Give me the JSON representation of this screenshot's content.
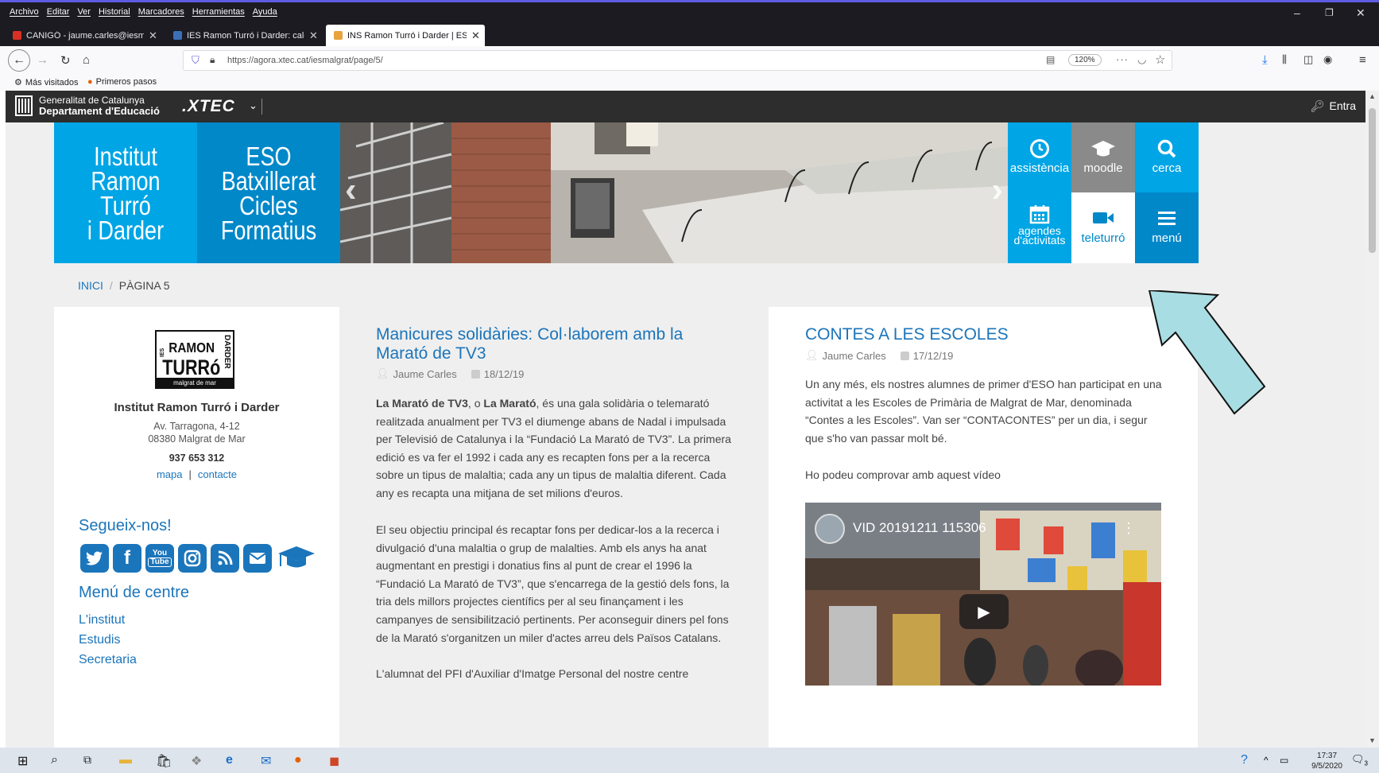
{
  "browser": {
    "menu": [
      "Archivo",
      "Editar",
      "Ver",
      "Historial",
      "Marcadores",
      "Herramientas",
      "Ayuda"
    ],
    "tabs": [
      {
        "label": "CANIGÓ - jaume.carles@iesma",
        "favicon_color": "#d93025"
      },
      {
        "label": "IES Ramon Turró i Darder: calen",
        "favicon_color": "#3b6fb6"
      },
      {
        "label": "INS Ramon Turró i Darder | ESO",
        "favicon_color": "#e8a33d"
      }
    ],
    "url": "https://agora.xtec.cat/iesmalgrat/page/5/",
    "zoom": "120%",
    "bookmarks": [
      "Más visitados",
      "Primeros pasos"
    ]
  },
  "xtec": {
    "gencat_line1": "Generalitat de Catalunya",
    "gencat_line2": "Departament d'Educació",
    "logo": ".XTEC",
    "login": "Entra"
  },
  "banner": {
    "title_lines": [
      "Institut",
      "Ramon Turró",
      "i Darder"
    ],
    "subtitle_lines": [
      "ESO Batxillerat",
      "Cicles",
      "Formatius"
    ],
    "tiles": [
      {
        "label": "assistència",
        "icon": "clock-icon",
        "bg": "#00a5e5"
      },
      {
        "label": "moodle",
        "icon": "mortarboard-icon",
        "bg": "#8a8a8a"
      },
      {
        "label": "cerca",
        "icon": "search-icon",
        "bg": "#00a5e5"
      },
      {
        "label": "agendes d'activitats",
        "icon": "calendar-icon",
        "bg": "#00a5e5"
      },
      {
        "label": "teleturró",
        "icon": "video-camera-icon",
        "bg": "#ffffff"
      },
      {
        "label": "menú",
        "icon": "hamburger-icon",
        "bg": "#0088c9"
      }
    ]
  },
  "breadcrumb": {
    "home": "INICI",
    "separator": "/",
    "current": "PÀGINA 5"
  },
  "sidebar": {
    "logo_lines": [
      "IES",
      "RAMON",
      "TURRó",
      "DARDER",
      "malgrat de mar"
    ],
    "school_name": "Institut Ramon Turró i Darder",
    "address1": "Av. Tarragona, 4-12",
    "address2": "08380 Malgrat de Mar",
    "phone": "937 653 312",
    "link_map": "mapa",
    "link_sep": "|",
    "link_contact": "contacte",
    "follow_title": "Segueix-nos!",
    "social": [
      {
        "icon": "twitter-icon",
        "glyph": "t"
      },
      {
        "icon": "facebook-icon",
        "glyph": "f"
      },
      {
        "icon": "youtube-icon",
        "glyph": "You Tube"
      },
      {
        "icon": "instagram-icon",
        "glyph": "◎"
      },
      {
        "icon": "rss-icon",
        "glyph": "◣"
      },
      {
        "icon": "mail-icon",
        "glyph": "✉"
      },
      {
        "icon": "moodle-icon",
        "glyph": "🎓"
      }
    ],
    "menu_title": "Menú de centre",
    "menu_items": [
      "L'institut",
      "Estudis",
      "Secretaria"
    ]
  },
  "posts": [
    {
      "title": "Manicures solidàries: Col·laborem amb la Marató de TV3",
      "author": "Jaume Carles",
      "date": "18/12/19",
      "para1": "La Marató de TV3, o La Marató, és una gala solidària o telemarató realitzada anualment per TV3 el diumenge abans de Nadal i impulsada per Televisió de Catalunya i la “Fundació La Marató de TV3”. La primera edició es va fer el 1992 i cada any es recapten fons per a la recerca sobre un tipus de malaltia; cada any un tipus de malaltia diferent. Cada any es recapta una mitjana de set milions d'euros.",
      "para1_bold1": "La Marató de TV3",
      "para1_mid": ", o ",
      "para1_bold2": "La Marató",
      "para1_rest": ", és una gala solidària o telemarató realitzada anualment per TV3 el diumenge abans de Nadal i impulsada per Televisió de Catalunya i la “Fundació La Marató de TV3”. La primera edició es va fer el 1992 i cada any es recapten fons per a la recerca sobre un tipus de malaltia; cada any un tipus de malaltia diferent. Cada any es recapta una mitjana de set milions d'euros.",
      "para2": "El seu objectiu principal és recaptar fons per dedicar-los a la recerca i divulgació d'una malaltia o grup de malalties. Amb els anys ha anat augmentant en prestigi i donatius fins al punt de crear el 1996 la “Fundació La Marató de TV3”, que s'encarrega de la gestió dels fons, la tria dels millors projectes científics per al seu finançament i les campanyes de sensibilització pertinents. Per aconseguir diners pel fons de la Marató s'organitzen un miler d'actes arreu dels Països Catalans.",
      "para3": "L'alumnat del PFI d'Auxiliar d'Imatge Personal del nostre centre"
    },
    {
      "title": "CONTES A LES ESCOLES",
      "author": "Jaume Carles",
      "date": "17/12/19",
      "para1": "Un any més, els nostres alumnes de primer d'ESO han participat en una activitat a les Escoles de Primària de Malgrat de Mar, denominada “Contes a les Escoles”. Van ser “CONTACONTES” per un dia, i segur que s'ho van passar molt bé.",
      "para2": "Ho podeu comprovar amb aquest vídeo",
      "video_title": "VID 20191211 115306"
    }
  ],
  "taskbar": {
    "time": "17:37",
    "date": "9/5/2020",
    "notifications": "3"
  },
  "colors": {
    "accent": "#00a5e5",
    "accent_dark": "#0088c9",
    "link": "#1b75bb",
    "arrow": "#a8dde3"
  }
}
